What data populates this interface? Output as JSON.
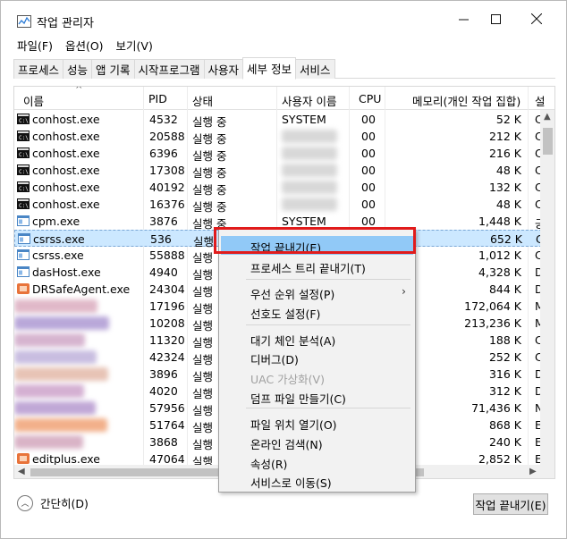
{
  "window": {
    "title": "작업 관리자"
  },
  "menu": [
    "파일(F)",
    "옵션(O)",
    "보기(V)"
  ],
  "tabs": [
    "프로세스",
    "성능",
    "앱 기록",
    "시작프로그램",
    "사용자",
    "세부 정보",
    "서비스"
  ],
  "active_tab": "세부 정보",
  "columns": {
    "name": "이름",
    "pid": "PID",
    "state": "상태",
    "user": "사용자 이름",
    "cpu": "CPU",
    "mem": "메모리(개인 작업 집합)",
    "desc": "설"
  },
  "rows": [
    {
      "name": "conhost.exe",
      "pid": "4532",
      "state": "실행 중",
      "user": "SYSTEM",
      "cpu": "00",
      "mem": "52 K",
      "desc": "C",
      "icon": "console-icon"
    },
    {
      "name": "conhost.exe",
      "pid": "20588",
      "state": "실행 중",
      "user": "",
      "cpu": "00",
      "mem": "212 K",
      "desc": "C",
      "icon": "console-icon"
    },
    {
      "name": "conhost.exe",
      "pid": "6396",
      "state": "실행 중",
      "user": "",
      "cpu": "00",
      "mem": "216 K",
      "desc": "C",
      "icon": "console-icon"
    },
    {
      "name": "conhost.exe",
      "pid": "17308",
      "state": "실행 중",
      "user": "",
      "cpu": "00",
      "mem": "48 K",
      "desc": "C",
      "icon": "console-icon"
    },
    {
      "name": "conhost.exe",
      "pid": "40192",
      "state": "실행 중",
      "user": "",
      "cpu": "00",
      "mem": "132 K",
      "desc": "C",
      "icon": "console-icon"
    },
    {
      "name": "conhost.exe",
      "pid": "16376",
      "state": "실행 중",
      "user": "",
      "cpu": "00",
      "mem": "48 K",
      "desc": "C",
      "icon": "console-icon"
    },
    {
      "name": "cpm.exe",
      "pid": "3876",
      "state": "실행 중",
      "user": "SYSTEM",
      "cpu": "00",
      "mem": "1,448 K",
      "desc": "긍",
      "icon": "window-icon"
    },
    {
      "name": "csrss.exe",
      "pid": "536",
      "state": "실행",
      "user": "",
      "cpu": "",
      "mem": "652 K",
      "desc": "C",
      "icon": "window-icon"
    },
    {
      "name": "csrss.exe",
      "pid": "55888",
      "state": "실행",
      "user": "",
      "cpu": "",
      "mem": "1,012 K",
      "desc": "C",
      "icon": "window-icon"
    },
    {
      "name": "dasHost.exe",
      "pid": "4940",
      "state": "실행",
      "user": "",
      "cpu": "",
      "mem": "4,328 K",
      "desc": "D",
      "icon": "window-icon"
    },
    {
      "name": "DRSafeAgent.exe",
      "pid": "24304",
      "state": "실행",
      "user": "",
      "cpu": "",
      "mem": "844 K",
      "desc": "D",
      "icon": "app-icon"
    },
    {
      "name": "",
      "pid": "17196",
      "state": "실행",
      "user": "",
      "cpu": "",
      "mem": "172,064 K",
      "desc": "M",
      "icon": ""
    },
    {
      "name": "",
      "pid": "10208",
      "state": "실행",
      "user": "",
      "cpu": "",
      "mem": "213,236 K",
      "desc": "M",
      "icon": ""
    },
    {
      "name": "",
      "pid": "11320",
      "state": "실행",
      "user": "",
      "cpu": "",
      "mem": "188 K",
      "desc": "C",
      "icon": ""
    },
    {
      "name": "",
      "pid": "42324",
      "state": "실행",
      "user": "",
      "cpu": "",
      "mem": "252 K",
      "desc": "C",
      "icon": ""
    },
    {
      "name": "",
      "pid": "3896",
      "state": "실행",
      "user": "",
      "cpu": "",
      "mem": "316 K",
      "desc": "D",
      "icon": ""
    },
    {
      "name": "",
      "pid": "4020",
      "state": "실행",
      "user": "",
      "cpu": "",
      "mem": "312 K",
      "desc": "D",
      "icon": ""
    },
    {
      "name": "",
      "pid": "57956",
      "state": "실행",
      "user": "",
      "cpu": "",
      "mem": "71,436 K",
      "desc": "N",
      "icon": ""
    },
    {
      "name": "",
      "pid": "51764",
      "state": "실행",
      "user": "",
      "cpu": "",
      "mem": "868 K",
      "desc": "E",
      "icon": ""
    },
    {
      "name": "",
      "pid": "3868",
      "state": "실행",
      "user": "",
      "cpu": "",
      "mem": "240 K",
      "desc": "E",
      "icon": ""
    },
    {
      "name": "editplus.exe",
      "pid": "47064",
      "state": "실행",
      "user": "",
      "cpu": "",
      "mem": "2,852 K",
      "desc": "E",
      "icon": "app-icon"
    }
  ],
  "selected_row": 7,
  "context_menu": [
    {
      "label": "작업 끝내기(E)",
      "state": "highlighted"
    },
    {
      "label": "프로세스 트리 끝내기(T)",
      "state": "normal"
    },
    {
      "label": "우선 순위 설정(P)",
      "state": "submenu"
    },
    {
      "label": "선호도 설정(F)",
      "state": "normal"
    },
    {
      "label": "대기 체인 분석(A)",
      "state": "normal"
    },
    {
      "label": "디버그(D)",
      "state": "normal"
    },
    {
      "label": "UAC 가상화(V)",
      "state": "disabled"
    },
    {
      "label": "덤프 파일 만들기(C)",
      "state": "normal"
    },
    {
      "label": "파일 위치 열기(O)",
      "state": "normal"
    },
    {
      "label": "온라인 검색(N)",
      "state": "normal"
    },
    {
      "label": "속성(R)",
      "state": "normal"
    },
    {
      "label": "서비스로 이동(S)",
      "state": "normal"
    }
  ],
  "footer": {
    "collapse_label": "간단히(D)",
    "end_task_button": "작업 끝내기(E)"
  },
  "colors": {
    "selection": "#cce8ff",
    "menu_highlight": "#91c9f7",
    "annotation_box": "#e11b1b"
  }
}
